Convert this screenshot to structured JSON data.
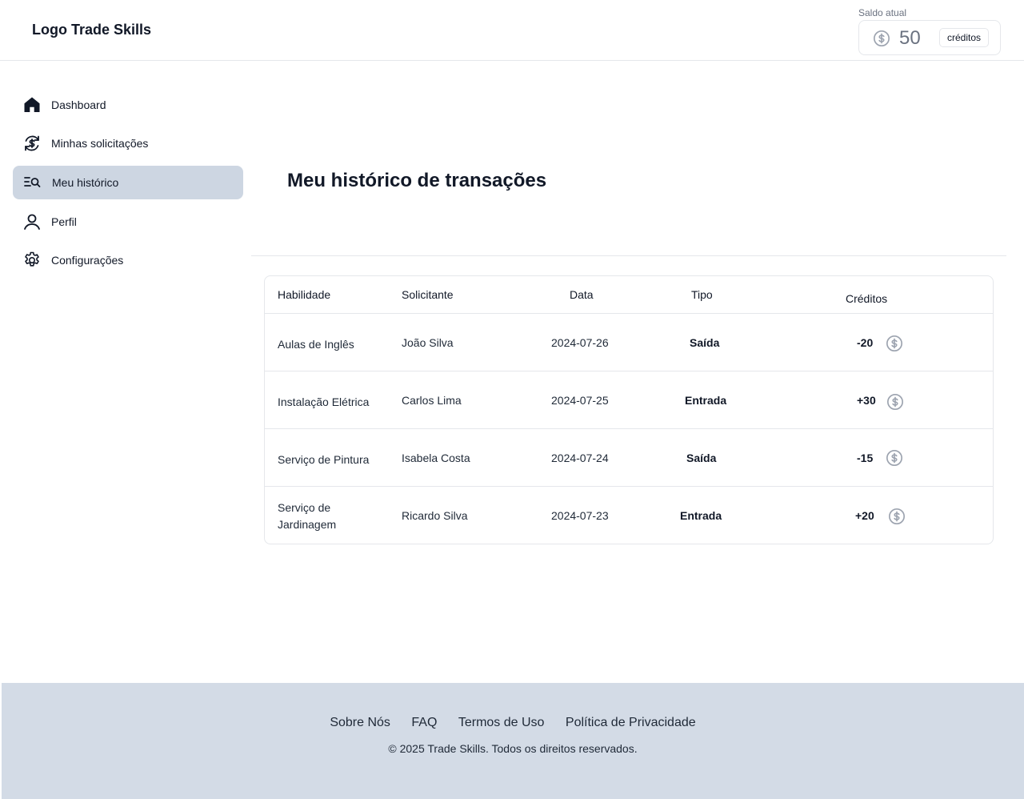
{
  "header": {
    "logo": "Logo Trade Skills",
    "balance_label": "Saldo atual",
    "balance_value": "50",
    "balance_unit": "créditos"
  },
  "sidebar": {
    "items": [
      {
        "label": "Dashboard",
        "icon": "home-icon",
        "active": false
      },
      {
        "label": "Minhas solicitações",
        "icon": "dollar-exchange-icon",
        "active": false
      },
      {
        "label": "Meu histórico",
        "icon": "list-search-icon",
        "active": true
      },
      {
        "label": "Perfil",
        "icon": "user-icon",
        "active": false
      },
      {
        "label": "Configurações",
        "icon": "gear-icon",
        "active": false
      }
    ]
  },
  "main": {
    "title": "Meu histórico de transações",
    "table": {
      "headers": [
        "Habilidade",
        "Solicitante",
        "Data",
        "Tipo",
        "Créditos"
      ],
      "rows": [
        {
          "skill": "Aulas de Inglês",
          "requester": "João Silva",
          "date": "2024-07-26",
          "type": "Saída",
          "credits": "-20"
        },
        {
          "skill": "Instalação Elétrica",
          "requester": "Carlos Lima",
          "date": "2024-07-25",
          "type": "Entrada",
          "credits": "+30"
        },
        {
          "skill": "Serviço de Pintura",
          "requester": "Isabela Costa",
          "date": "2024-07-24",
          "type": "Saída",
          "credits": "-15"
        },
        {
          "skill": "Serviço de Jardinagem",
          "requester": "Ricardo Silva",
          "date": "2024-07-23",
          "type": "Entrada",
          "credits": "+20"
        }
      ]
    }
  },
  "footer": {
    "links": [
      "Sobre Nós",
      "FAQ",
      "Termos de Uso",
      "Política de Privacidade"
    ],
    "copyright": "© 2025 Trade Skills. Todos os direitos reservados."
  },
  "colors": {
    "active_nav_bg": "#cdd6e2",
    "footer_bg": "#d3dbe6",
    "coin_gray": "#9ca3af"
  }
}
